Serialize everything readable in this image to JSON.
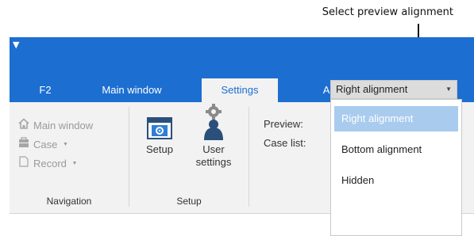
{
  "callout": {
    "text": "Select preview alignment"
  },
  "tabs": [
    {
      "label": "F2"
    },
    {
      "label": "Main window"
    },
    {
      "label": "Settings",
      "active": true
    },
    {
      "label": "Administrator"
    }
  ],
  "navigation": {
    "items": [
      {
        "label": "Main window",
        "icon": "home-icon"
      },
      {
        "label": "Case",
        "icon": "case-icon",
        "has_dropdown": true
      },
      {
        "label": "Record",
        "icon": "document-icon",
        "has_dropdown": true
      }
    ],
    "group_label": "Navigation"
  },
  "setup": {
    "setup_button": "Setup",
    "user_settings_line1": "User",
    "user_settings_line2": "settings",
    "group_label": "Setup"
  },
  "settings": {
    "preview_label": "Preview:",
    "case_list_label": "Case list:",
    "preview_value": "Right alignment",
    "options": [
      {
        "label": "Right alignment",
        "selected": true
      },
      {
        "label": "Bottom alignment"
      },
      {
        "label": "Hidden"
      }
    ]
  },
  "colors": {
    "accent": "#1c6ed1",
    "selected_option": "#a9cbee",
    "ribbon_bg": "#f2f2f2"
  },
  "symbols": {
    "dropdown_arrow": "▼",
    "qat": "▼"
  }
}
